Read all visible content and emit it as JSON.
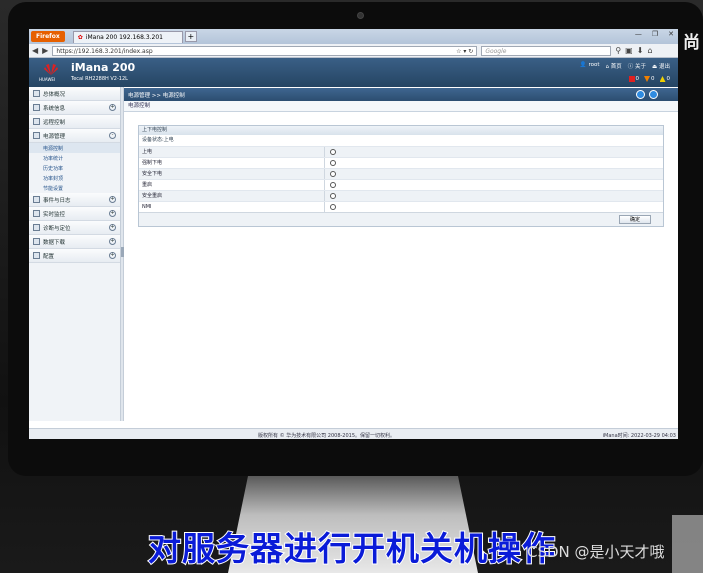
{
  "browser": {
    "app_button": "Firefox",
    "tab_title": "iMana 200 192.168.3.201",
    "tab_new": "+",
    "url": "https://192.168.3.201/index.asp",
    "search_placeholder": "Google"
  },
  "header": {
    "logo_text": "HUAWEI",
    "product": "iMana 200",
    "model": "Tecal RH2288H V2-12L",
    "links": [
      "root",
      "首页",
      "关于",
      "退出"
    ],
    "alerts": [
      "0",
      "0",
      "0"
    ]
  },
  "sidebar": {
    "items": [
      {
        "label": "总体概况"
      },
      {
        "label": "系统信息",
        "expander": "+"
      },
      {
        "label": "远程控制"
      },
      {
        "label": "电源管理",
        "expander": "-"
      }
    ],
    "subitems": [
      "电源控制",
      "功率统计",
      "历史功率",
      "功率封顶",
      "节能设置"
    ],
    "items_after": [
      {
        "label": "事件与日志",
        "expander": "+"
      },
      {
        "label": "实时监控",
        "expander": "+"
      },
      {
        "label": "诊断与定位",
        "expander": "+"
      },
      {
        "label": "数据下载",
        "expander": "+"
      },
      {
        "label": "配置",
        "expander": "+"
      }
    ]
  },
  "main": {
    "breadcrumb": "电源管理  >>  电源控制",
    "subtitle": "电源控制",
    "panel_title": "上下电控制",
    "status": "设备状态:上电",
    "options": [
      "上电",
      "强制下电",
      "安全下电",
      "重启",
      "安全重启",
      "NMI"
    ],
    "ok_label": "确定"
  },
  "footer": {
    "copyright": "版权所有 © 华为技术有限公司 2008-2015。保留一切权利。",
    "time": "iMana时间:   2022-03-29 04:03"
  },
  "overlay": {
    "caption": "对服务器进行开机关机操作",
    "watermark": "CSDN @是小天才哦",
    "side_text": "尚"
  }
}
